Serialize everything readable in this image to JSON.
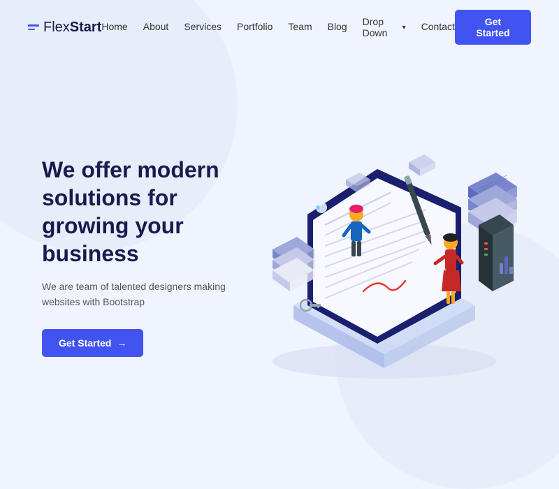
{
  "logo": {
    "text_flex": "Flex",
    "text_start": "Start",
    "full": "FlexStart"
  },
  "nav": {
    "links": [
      {
        "label": "Home",
        "id": "home"
      },
      {
        "label": "About",
        "id": "about"
      },
      {
        "label": "Services",
        "id": "services"
      },
      {
        "label": "Portfolio",
        "id": "portfolio"
      },
      {
        "label": "Team",
        "id": "team"
      },
      {
        "label": "Blog",
        "id": "blog"
      },
      {
        "label": "Drop Down",
        "id": "dropdown",
        "has_chevron": true
      },
      {
        "label": "Contact",
        "id": "contact"
      }
    ],
    "cta_label": "Get Started"
  },
  "hero": {
    "title": "We offer modern solutions for growing your business",
    "subtitle": "We are team of talented designers making websites with Bootstrap",
    "cta_label": "Get Started",
    "cta_arrow": "→"
  },
  "colors": {
    "primary": "#4154f1",
    "dark_text": "#1a1a4e",
    "body_text": "#555",
    "bg": "#f0f4ff",
    "blob": "#e8eef9"
  }
}
